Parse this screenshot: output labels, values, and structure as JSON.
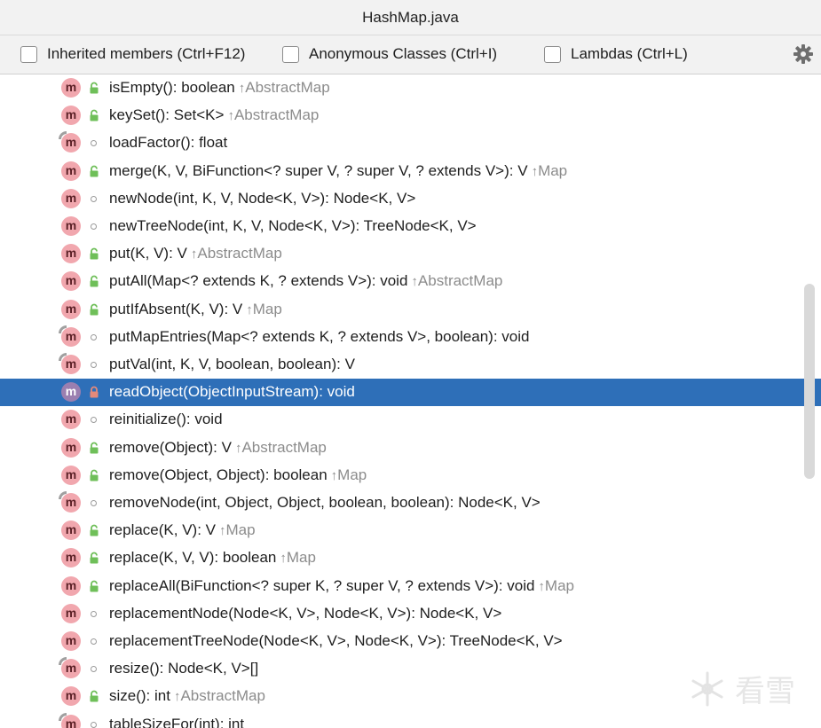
{
  "window": {
    "title": "HashMap.java"
  },
  "options": {
    "inherited": "Inherited members (Ctrl+F12)",
    "anonymous": "Anonymous Classes (Ctrl+I)",
    "lambdas": "Lambdas (Ctrl+L)"
  },
  "icons": {
    "settings": "gear-icon",
    "method": "method-m-icon",
    "public": "unlocked-padlock-icon",
    "package": "circle-icon",
    "private": "locked-padlock-icon"
  },
  "colors": {
    "selection": "#2e6fb8",
    "method_badge": "#f1a7ae",
    "public_lock": "#6fbf59",
    "inherited_text": "#8c8c8c"
  },
  "members": [
    {
      "signature": "isEmpty(): boolean",
      "inherited": "AbstractMap",
      "visibility": "public",
      "pinned": false
    },
    {
      "signature": "keySet(): Set<K>",
      "inherited": "AbstractMap",
      "visibility": "public",
      "pinned": false
    },
    {
      "signature": "loadFactor(): float",
      "inherited": "",
      "visibility": "package",
      "pinned": true
    },
    {
      "signature": "merge(K, V, BiFunction<? super V, ? super V, ? extends V>): V",
      "inherited": "Map",
      "visibility": "public",
      "pinned": false
    },
    {
      "signature": "newNode(int, K, V, Node<K, V>): Node<K, V>",
      "inherited": "",
      "visibility": "package",
      "pinned": false
    },
    {
      "signature": "newTreeNode(int, K, V, Node<K, V>): TreeNode<K, V>",
      "inherited": "",
      "visibility": "package",
      "pinned": false
    },
    {
      "signature": "put(K, V): V",
      "inherited": "AbstractMap",
      "visibility": "public",
      "pinned": false
    },
    {
      "signature": "putAll(Map<? extends K, ? extends V>): void",
      "inherited": "AbstractMap",
      "visibility": "public",
      "pinned": false
    },
    {
      "signature": "putIfAbsent(K, V): V",
      "inherited": "Map",
      "visibility": "public",
      "pinned": false
    },
    {
      "signature": "putMapEntries(Map<? extends K, ? extends V>, boolean): void",
      "inherited": "",
      "visibility": "package",
      "pinned": true
    },
    {
      "signature": "putVal(int, K, V, boolean, boolean): V",
      "inherited": "",
      "visibility": "package",
      "pinned": true
    },
    {
      "signature": "readObject(ObjectInputStream): void",
      "inherited": "",
      "visibility": "private",
      "pinned": false,
      "selected": true
    },
    {
      "signature": "reinitialize(): void",
      "inherited": "",
      "visibility": "package",
      "pinned": false
    },
    {
      "signature": "remove(Object): V",
      "inherited": "AbstractMap",
      "visibility": "public",
      "pinned": false
    },
    {
      "signature": "remove(Object, Object): boolean",
      "inherited": "Map",
      "visibility": "public",
      "pinned": false
    },
    {
      "signature": "removeNode(int, Object, Object, boolean, boolean): Node<K, V>",
      "inherited": "",
      "visibility": "package",
      "pinned": true
    },
    {
      "signature": "replace(K, V): V",
      "inherited": "Map",
      "visibility": "public",
      "pinned": false
    },
    {
      "signature": "replace(K, V, V): boolean",
      "inherited": "Map",
      "visibility": "public",
      "pinned": false
    },
    {
      "signature": "replaceAll(BiFunction<? super K, ? super V, ? extends V>): void",
      "inherited": "Map",
      "visibility": "public",
      "pinned": false
    },
    {
      "signature": "replacementNode(Node<K, V>, Node<K, V>): Node<K, V>",
      "inherited": "",
      "visibility": "package",
      "pinned": false
    },
    {
      "signature": "replacementTreeNode(Node<K, V>, Node<K, V>): TreeNode<K, V>",
      "inherited": "",
      "visibility": "package",
      "pinned": false
    },
    {
      "signature": "resize(): Node<K, V>[]",
      "inherited": "",
      "visibility": "package",
      "pinned": true
    },
    {
      "signature": "size(): int",
      "inherited": "AbstractMap",
      "visibility": "public",
      "pinned": false
    },
    {
      "signature": "tableSizeFor(int): int",
      "inherited": "",
      "visibility": "package",
      "pinned": true
    }
  ],
  "watermark": {
    "text": "看雪"
  }
}
